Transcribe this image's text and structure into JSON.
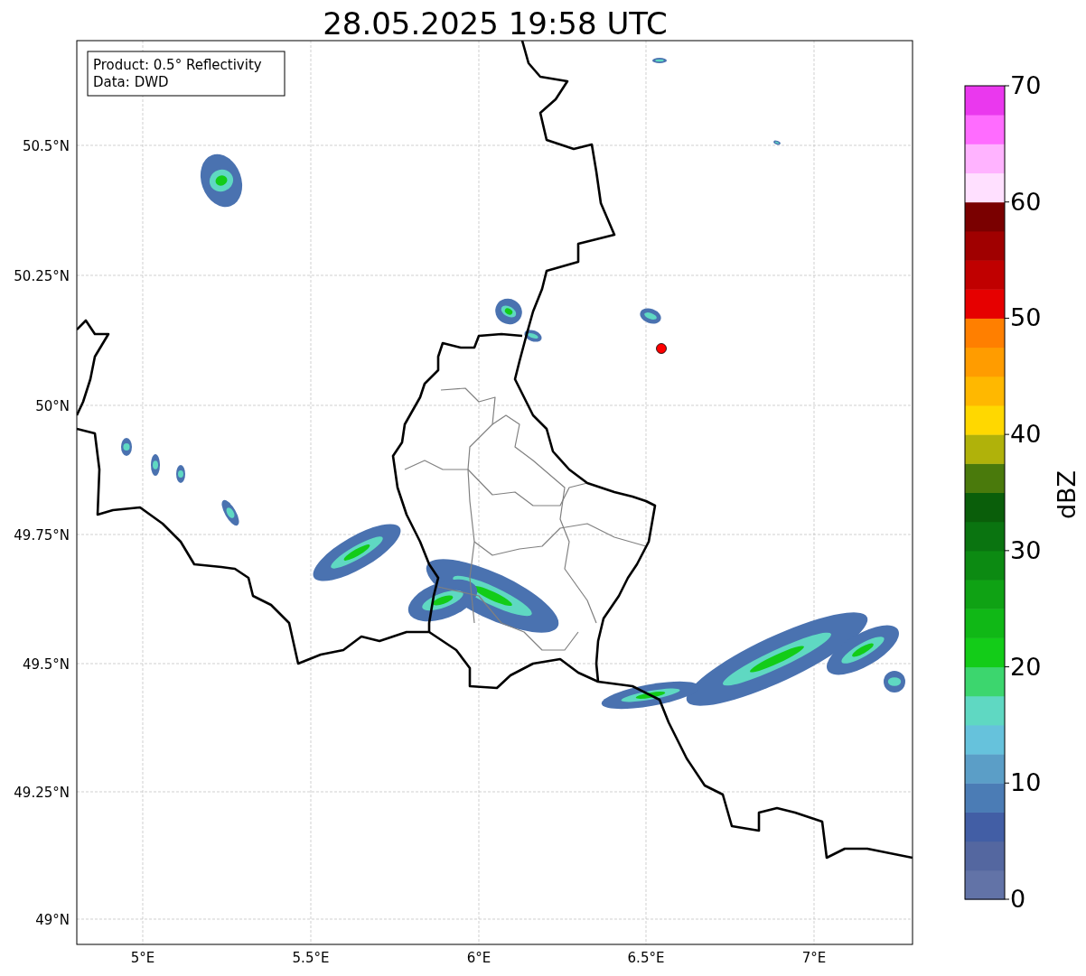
{
  "title": "28.05.2025 19:58 UTC",
  "info_box": {
    "lines": [
      "Product: 0.5° Reflectivity",
      "Data: DWD"
    ]
  },
  "map": {
    "lat_labels": [
      "50.5°N",
      "50.25°N",
      "50°N",
      "49.75°N",
      "49.5°N",
      "49.25°N",
      "49°N"
    ],
    "lon_labels": [
      "5°E",
      "5.5°E",
      "6°E",
      "6.5°E",
      "7°E"
    ]
  },
  "colorbar": {
    "label": "dBZ",
    "ticks": [
      "70",
      "60",
      "50",
      "40",
      "30",
      "20",
      "10",
      "0"
    ],
    "bands": [
      {
        "color": "#6273a7"
      },
      {
        "color": "#5467a0"
      },
      {
        "color": "#425ea5"
      },
      {
        "color": "#4b7cb5"
      },
      {
        "color": "#5b9ec7"
      },
      {
        "color": "#66c2dc"
      },
      {
        "color": "#5fd8c2"
      },
      {
        "color": "#3cd66e"
      },
      {
        "color": "#13cc18"
      },
      {
        "color": "#10b816"
      },
      {
        "color": "#0fa214"
      },
      {
        "color": "#0c8a12"
      },
      {
        "color": "#0a7410"
      },
      {
        "color": "#0a5e0a"
      },
      {
        "color": "#4a7a0c"
      },
      {
        "color": "#b0b20a"
      },
      {
        "color": "#ffd800"
      },
      {
        "color": "#ffb800"
      },
      {
        "color": "#ff9c00"
      },
      {
        "color": "#ff7f00"
      },
      {
        "color": "#e60000"
      },
      {
        "color": "#c00000"
      },
      {
        "color": "#a00000"
      },
      {
        "color": "#7a0000"
      },
      {
        "color": "#ffe0ff"
      },
      {
        "color": "#ffb3ff"
      },
      {
        "color": "#ff6cff"
      },
      {
        "color": "#ea38ee"
      }
    ]
  }
}
